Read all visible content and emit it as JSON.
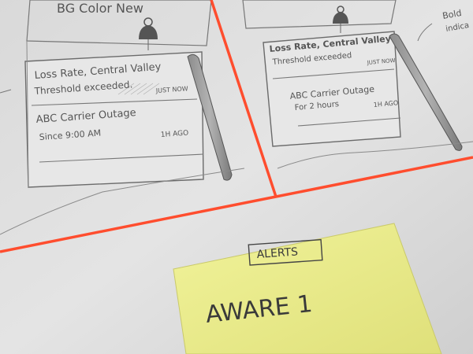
{
  "left_panel": {
    "header_text": "BG Color New",
    "alert_1": {
      "title": "Loss Rate, Central Valley",
      "subtitle": "Threshold exceeded.",
      "time": "JUST NOW"
    },
    "alert_2": {
      "title": "ABC Carrier Outage",
      "subtitle": "Since 9:00 AM",
      "time": "1H AGO"
    }
  },
  "right_panel": {
    "side_note": "Bold",
    "side_note_2": "indica",
    "alert_1": {
      "title": "Loss Rate, Central Valley",
      "subtitle": "Threshold exceeded",
      "time": "JUST NOW"
    },
    "alert_2": {
      "title": "ABC Carrier Outage",
      "subtitle": "For 2 hours",
      "time": "1H AGO"
    }
  },
  "sticky_note": {
    "label": "ALERTS",
    "text": "AWARE 1"
  },
  "colors": {
    "paper": "#e2e2e2",
    "red_marker": "#ff4d2e",
    "postit": "#eef08a",
    "pencil": "#6b6b6b"
  },
  "icons": [
    "bell-icon",
    "bell-icon"
  ]
}
